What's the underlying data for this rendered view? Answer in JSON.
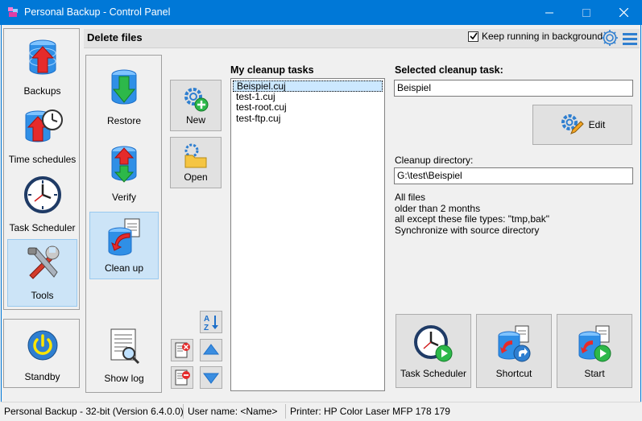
{
  "window": {
    "title": "Personal Backup - Control Panel",
    "minimize_icon": "minimize-icon",
    "maximize_icon": "maximize-icon",
    "close_icon": "close-icon"
  },
  "nav": {
    "items": [
      {
        "label": "Backups",
        "icon": "database-up-arrow-icon"
      },
      {
        "label": "Time schedules",
        "icon": "clock-database-icon"
      },
      {
        "label": "Task Scheduler",
        "icon": "clock-icon"
      },
      {
        "label": "Tools",
        "icon": "tools-icon",
        "selected": true
      }
    ],
    "standby": {
      "label": "Standby",
      "icon": "power-icon"
    }
  },
  "header": {
    "title": "Delete files",
    "keep_running_label": "Keep running in background",
    "keep_running_checked": true
  },
  "subnav": {
    "items": [
      {
        "label": "Restore",
        "icon": "database-down-arrow-icon"
      },
      {
        "label": "Verify",
        "icon": "database-verify-icon"
      },
      {
        "label": "Clean up",
        "icon": "cleanup-icon",
        "selected": true
      },
      {
        "label": "Show log",
        "icon": "log-icon"
      }
    ]
  },
  "toolbar": {
    "new_label": "New",
    "open_label": "Open"
  },
  "tasks": {
    "title": "My cleanup tasks",
    "items": [
      "Beispiel.cuj",
      "test-1.cuj",
      "test-root.cuj",
      "test-ftp.cuj"
    ],
    "selected_index": 0
  },
  "selected": {
    "title": "Selected cleanup task:",
    "name": "Beispiel",
    "edit_label": "Edit",
    "dir_label": "Cleanup directory:",
    "dir_value": "G:\\test\\Beispiel",
    "description": [
      "All files",
      "older than 2 months",
      "all except these file types: \"tmp,bak\"",
      "Synchronize with source directory"
    ]
  },
  "actions": {
    "task_scheduler_label": "Task Scheduler",
    "shortcut_label": "Shortcut",
    "start_label": "Start"
  },
  "status": {
    "version": "Personal Backup - 32-bit (Version 6.4.0.0)",
    "user": "User name: <Name>",
    "printer": "Printer: HP Color Laser MFP 178 179"
  },
  "colors": {
    "titlebar": "#0078d7",
    "selected_bg": "#cce4f7",
    "selected_border": "#99c9ef"
  }
}
